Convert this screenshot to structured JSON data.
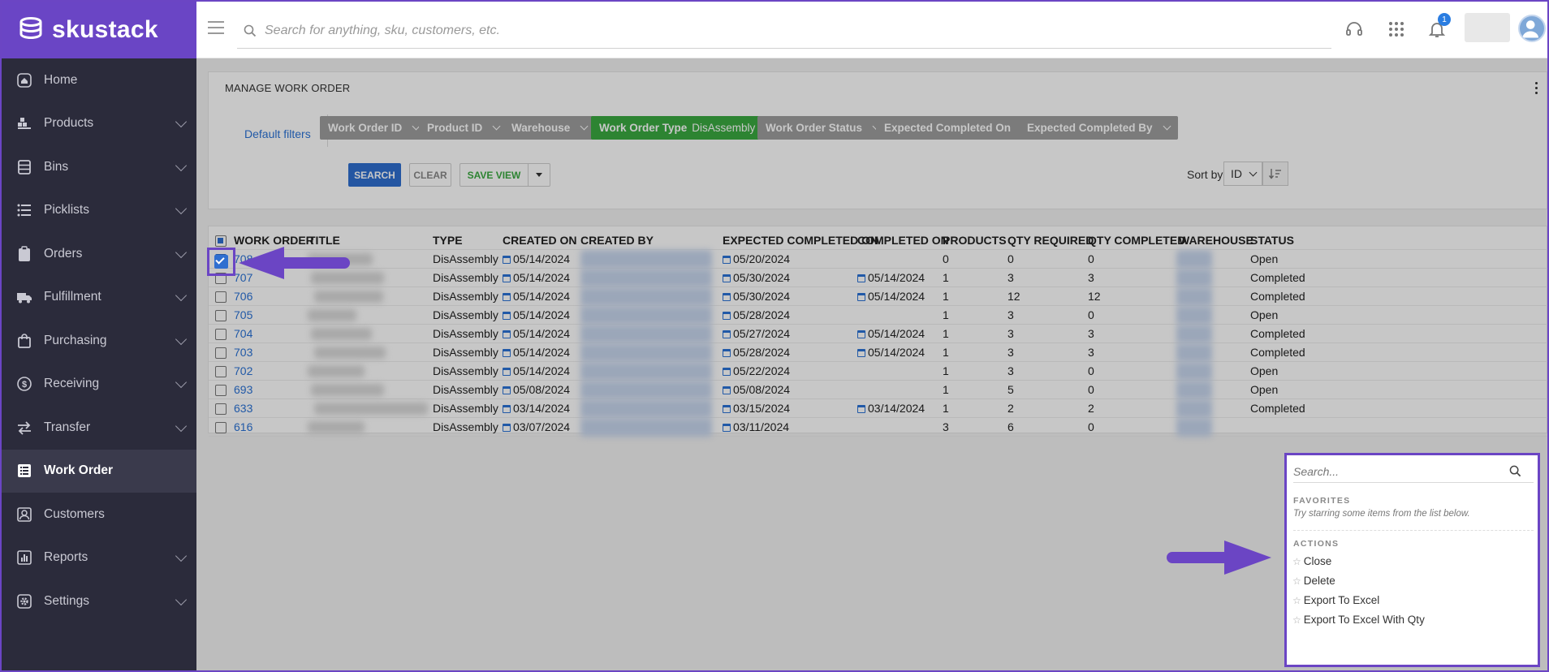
{
  "app": {
    "brand_name": "skustack"
  },
  "search": {
    "placeholder": "Search for anything, sku, customers, etc."
  },
  "notifications": {
    "count": "1"
  },
  "sidebar": {
    "items": [
      {
        "label": "Home",
        "icon": "home-icon",
        "expandable": false,
        "active": false
      },
      {
        "label": "Products",
        "icon": "products-icon",
        "expandable": true,
        "active": false
      },
      {
        "label": "Bins",
        "icon": "bins-icon",
        "expandable": true,
        "active": false
      },
      {
        "label": "Picklists",
        "icon": "picklists-icon",
        "expandable": true,
        "active": false
      },
      {
        "label": "Orders",
        "icon": "orders-icon",
        "expandable": true,
        "active": false
      },
      {
        "label": "Fulfillment",
        "icon": "truck-icon",
        "expandable": true,
        "active": false
      },
      {
        "label": "Purchasing",
        "icon": "bag-icon",
        "expandable": true,
        "active": false
      },
      {
        "label": "Receiving",
        "icon": "dollar-icon",
        "expandable": true,
        "active": false
      },
      {
        "label": "Transfer",
        "icon": "transfer-icon",
        "expandable": true,
        "active": false
      },
      {
        "label": "Work Order",
        "icon": "work-order-icon",
        "expandable": false,
        "active": true
      },
      {
        "label": "Customers",
        "icon": "customers-icon",
        "expandable": false,
        "active": false
      },
      {
        "label": "Reports",
        "icon": "reports-icon",
        "expandable": true,
        "active": false
      },
      {
        "label": "Settings",
        "icon": "gear-icon",
        "expandable": true,
        "active": false
      }
    ]
  },
  "page": {
    "title": "MANAGE WORK ORDER"
  },
  "filters": {
    "default_label": "Default filters",
    "chips": [
      {
        "label": "Work Order ID",
        "value": ""
      },
      {
        "label": "Product ID",
        "value": ""
      },
      {
        "label": "Warehouse",
        "value": ""
      },
      {
        "label": "Work Order Type",
        "value": "DisAssembly",
        "active": true
      },
      {
        "label": "Work Order Status",
        "value": ""
      },
      {
        "label": "Expected Completed On",
        "value": ""
      },
      {
        "label": "Expected Completed By",
        "value": ""
      }
    ],
    "search_label": "SEARCH",
    "clear_label": "CLEAR",
    "save_view_label": "SAVE VIEW",
    "sort_by_label": "Sort by",
    "sort_value": "ID"
  },
  "table": {
    "columns": [
      "WORK ORDER",
      "TITLE",
      "TYPE",
      "CREATED ON",
      "CREATED BY",
      "EXPECTED COMPLETED ON",
      "COMPLETED ON",
      "PRODUCTS",
      "QTY REQUIRED",
      "QTY COMPLETED",
      "WAREHOUSE",
      "STATUS"
    ],
    "rows": [
      {
        "id": "708",
        "type": "DisAssembly",
        "created_on": "05/14/2024",
        "expected": "05/20/2024",
        "completed": "",
        "products": "0",
        "qty_required": "0",
        "qty_completed": "0",
        "status": "Open",
        "checked": true
      },
      {
        "id": "707",
        "type": "DisAssembly",
        "created_on": "05/14/2024",
        "expected": "05/30/2024",
        "completed": "05/14/2024",
        "products": "1",
        "qty_required": "3",
        "qty_completed": "3",
        "status": "Completed",
        "checked": false
      },
      {
        "id": "706",
        "type": "DisAssembly",
        "created_on": "05/14/2024",
        "expected": "05/30/2024",
        "completed": "05/14/2024",
        "products": "1",
        "qty_required": "12",
        "qty_completed": "12",
        "status": "Completed",
        "checked": false
      },
      {
        "id": "705",
        "type": "DisAssembly",
        "created_on": "05/14/2024",
        "expected": "05/28/2024",
        "completed": "",
        "products": "1",
        "qty_required": "3",
        "qty_completed": "0",
        "status": "Open",
        "checked": false
      },
      {
        "id": "704",
        "type": "DisAssembly",
        "created_on": "05/14/2024",
        "expected": "05/27/2024",
        "completed": "05/14/2024",
        "products": "1",
        "qty_required": "3",
        "qty_completed": "3",
        "status": "Completed",
        "checked": false
      },
      {
        "id": "703",
        "type": "DisAssembly",
        "created_on": "05/14/2024",
        "expected": "05/28/2024",
        "completed": "05/14/2024",
        "products": "1",
        "qty_required": "3",
        "qty_completed": "3",
        "status": "Completed",
        "checked": false
      },
      {
        "id": "702",
        "type": "DisAssembly",
        "created_on": "05/14/2024",
        "expected": "05/22/2024",
        "completed": "",
        "products": "1",
        "qty_required": "3",
        "qty_completed": "0",
        "status": "Open",
        "checked": false
      },
      {
        "id": "693",
        "type": "DisAssembly",
        "created_on": "05/08/2024",
        "expected": "05/08/2024",
        "completed": "",
        "products": "1",
        "qty_required": "5",
        "qty_completed": "0",
        "status": "Open",
        "checked": false
      },
      {
        "id": "633",
        "type": "DisAssembly",
        "created_on": "03/14/2024",
        "expected": "03/15/2024",
        "completed": "03/14/2024",
        "products": "1",
        "qty_required": "2",
        "qty_completed": "2",
        "status": "Completed",
        "checked": false
      },
      {
        "id": "616",
        "type": "DisAssembly",
        "created_on": "03/07/2024",
        "expected": "03/11/2024",
        "completed": "",
        "products": "3",
        "qty_required": "6",
        "qty_completed": "0",
        "status": "",
        "checked": false
      }
    ]
  },
  "actions_popup": {
    "search_placeholder": "Search...",
    "favorites_title": "FAVORITES",
    "favorites_hint": "Try starring some items from the list below.",
    "actions_title": "ACTIONS",
    "items": [
      "Close",
      "Delete",
      "Export To Excel",
      "Export To Excel With Qty"
    ]
  },
  "colors": {
    "brand": "#6a45c5",
    "sidebar": "#2b2b3b",
    "accent": "#2b73d6",
    "active_chip": "#3aa940",
    "annotation": "#6b45c4"
  }
}
